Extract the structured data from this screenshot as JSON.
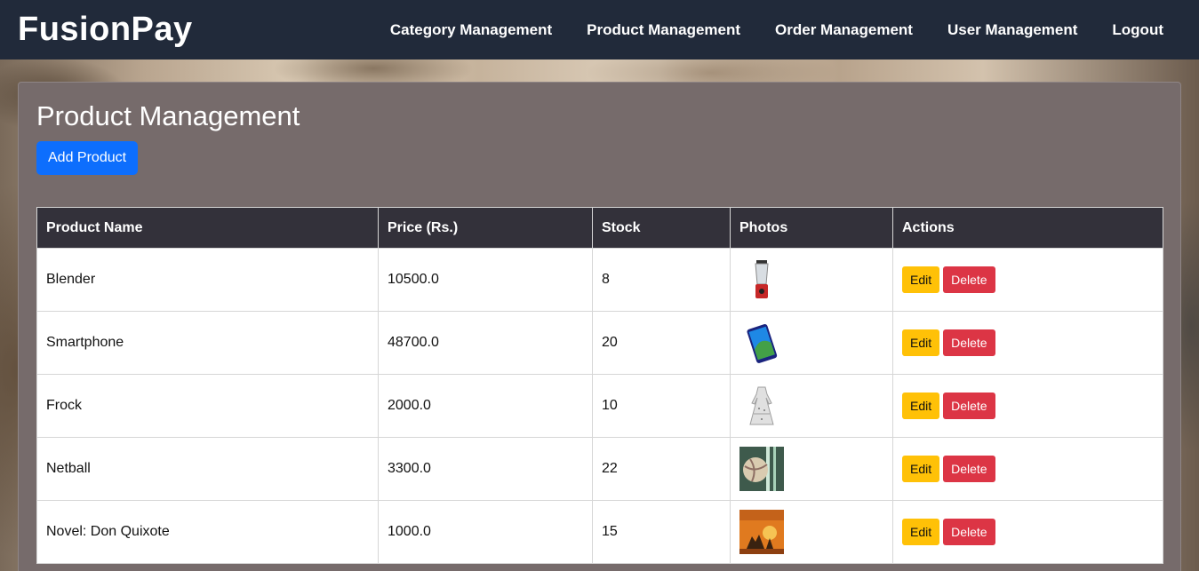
{
  "brand": "FusionPay",
  "nav": [
    {
      "label": "Category Management"
    },
    {
      "label": "Product Management"
    },
    {
      "label": "Order Management"
    },
    {
      "label": "User Management"
    },
    {
      "label": "Logout"
    }
  ],
  "page": {
    "title": "Product Management",
    "add_button": "Add Product"
  },
  "table": {
    "headers": [
      "Product Name",
      "Price (Rs.)",
      "Stock",
      "Photos",
      "Actions"
    ],
    "rows": [
      {
        "name": "Blender",
        "price": "10500.0",
        "stock": "8",
        "photo": "blender-photo"
      },
      {
        "name": "Smartphone",
        "price": "48700.0",
        "stock": "20",
        "photo": "smartphone-photo"
      },
      {
        "name": "Frock",
        "price": "2000.0",
        "stock": "10",
        "photo": "frock-photo"
      },
      {
        "name": "Netball",
        "price": "3300.0",
        "stock": "22",
        "photo": "netball-photo"
      },
      {
        "name": "Novel: Don Quixote",
        "price": "1000.0",
        "stock": "15",
        "photo": "book-cover-photo"
      }
    ],
    "edit_label": "Edit",
    "delete_label": "Delete"
  },
  "colors": {
    "navbar": "#212a3a",
    "panel": "#766b6b",
    "primary": "#0d6efd",
    "warning": "#ffc107",
    "danger": "#dc3545",
    "table_header": "#33313a"
  }
}
